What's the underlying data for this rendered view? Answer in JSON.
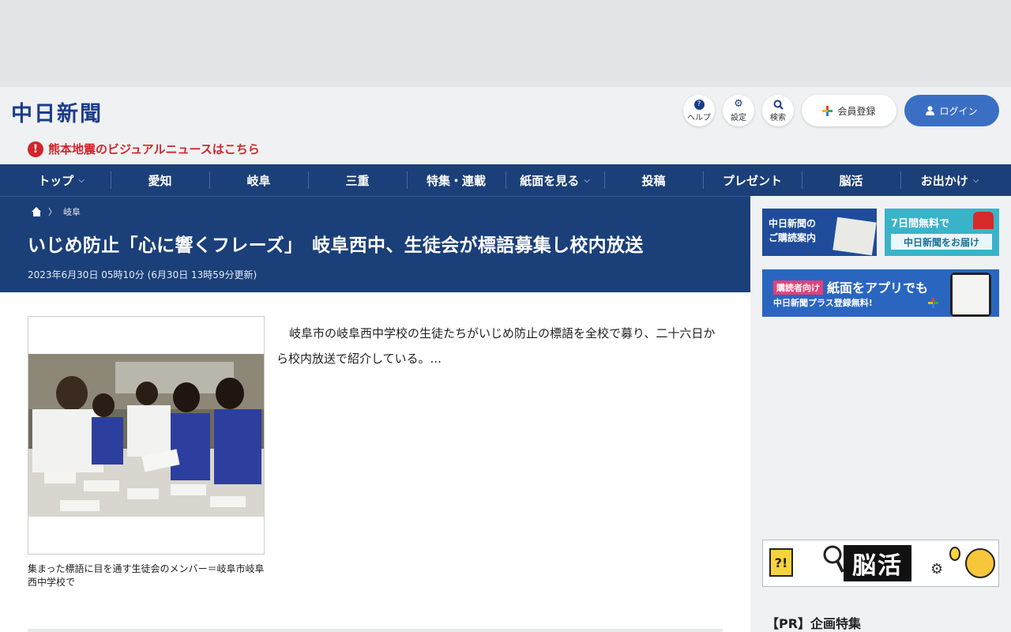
{
  "header": {
    "logo": "中日新聞",
    "alert_text": "熊本地震のビジュアルニュースはこちら",
    "help_label": "ヘルプ",
    "settings_label": "設定",
    "search_label": "検索",
    "register_label": "会員登録",
    "login_label": "ログイン"
  },
  "nav": {
    "items": [
      {
        "label": "トップ"
      },
      {
        "label": "愛知"
      },
      {
        "label": "岐阜"
      },
      {
        "label": "三重"
      },
      {
        "label": "特集・連載"
      },
      {
        "label": "紙面を見る"
      },
      {
        "label": "投稿"
      },
      {
        "label": "プレゼント"
      },
      {
        "label": "脳活"
      },
      {
        "label": "お出かけ"
      }
    ]
  },
  "article": {
    "breadcrumb_section": "岐阜",
    "title": "いじめ防止「心に響くフレーズ」　岐阜西中、生徒会が標語募集し校内放送",
    "date": "2023年6月30日 05時10分 (6月30日 13時59分更新)",
    "body": "岐阜市の岐阜西中学校の生徒たちがいじめ防止の標語を全校で募り、二十六日から校内放送で紹介している。...",
    "photo_caption": "集まった標語に目を通す生徒会のメンバー＝岐阜市岐阜西中学校で"
  },
  "sidebar": {
    "banner1_line1": "中日新聞の",
    "banner1_line2": "ご購読案内",
    "banner2_line1": "7日間無料で",
    "banner2_line2": "中日新聞をお届け",
    "banner3_tag": "購読者向け",
    "banner3_main": "紙面をアプリでも",
    "banner3_sub": "中日新聞プラス登録無料!",
    "banner4_text": "脳活",
    "pr_title": "【PR】企画特集"
  }
}
